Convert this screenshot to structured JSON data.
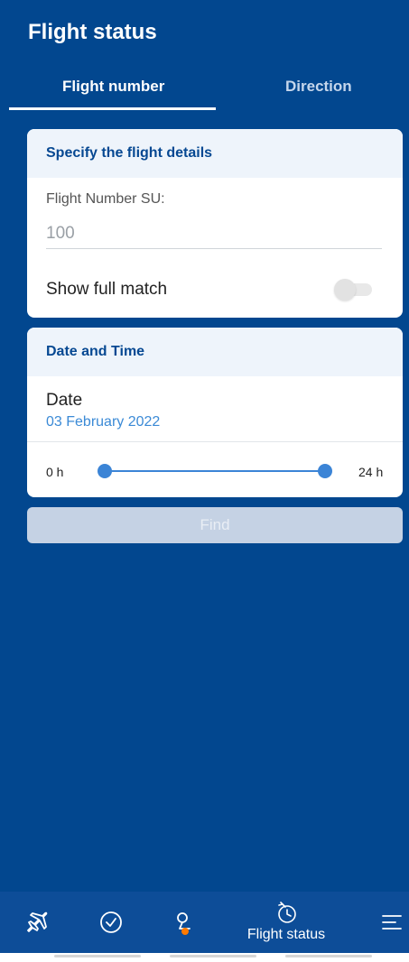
{
  "header": {
    "title": "Flight status"
  },
  "tabs": [
    {
      "label": "Flight number",
      "active": true
    },
    {
      "label": "Direction",
      "active": false
    }
  ],
  "flight_details": {
    "header": "Specify the flight details",
    "field_label": "Flight Number SU:",
    "field_value": "",
    "field_placeholder": "100",
    "match_label": "Show full match",
    "match_enabled": false
  },
  "date_time": {
    "header": "Date and Time",
    "date_label": "Date",
    "date_value": "03 February 2022",
    "range_min_label": "0 h",
    "range_max_label": "24 h",
    "range_start_fraction": 0,
    "range_end_fraction": 1
  },
  "find_button": {
    "label": "Find",
    "enabled": false
  },
  "bottom_nav": {
    "items": [
      {
        "icon": "plane-icon"
      },
      {
        "icon": "check-circle-icon"
      },
      {
        "icon": "profile-icon",
        "badge_color": "#ff7a00"
      },
      {
        "icon": "flight-status-icon",
        "label": "Flight status",
        "active": true
      },
      {
        "icon": "menu-icon"
      }
    ]
  },
  "colors": {
    "background": "#02478f",
    "accent": "#3b84d6",
    "card_header_bg": "#eef4fb",
    "card_header_text": "#064892",
    "disabled_button": "#c5d2e4"
  }
}
